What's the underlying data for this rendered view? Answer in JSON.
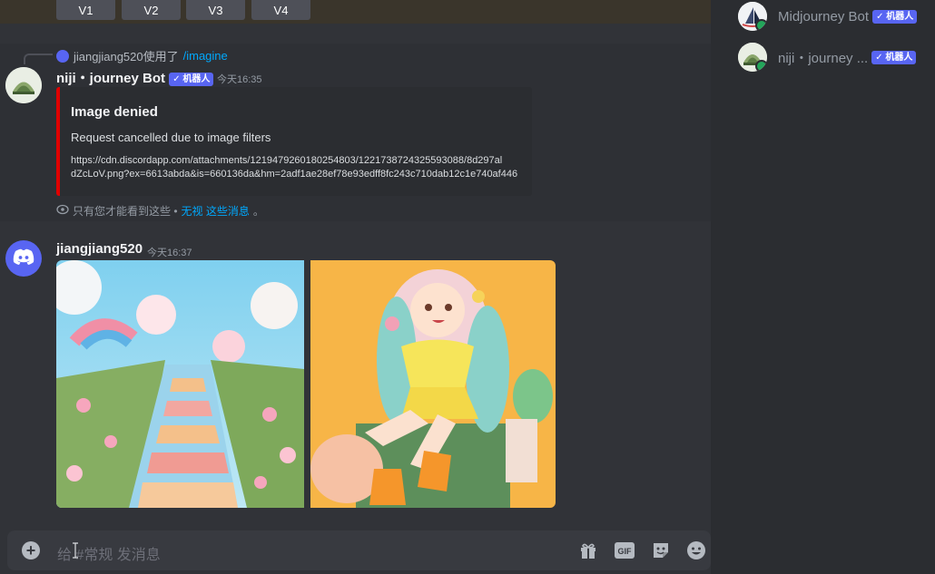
{
  "vbuttons": [
    "V1",
    "V2",
    "V3",
    "V4"
  ],
  "reply": {
    "user": "jiangjiang520使用了",
    "command": "/imagine"
  },
  "bot_message": {
    "name": "niji・journey Bot",
    "badge": "✓ 机器人",
    "time": "今天16:35",
    "embed": {
      "title": "Image denied",
      "description": "Request cancelled due to image filters",
      "url_line1": "https://cdn.discordapp.com/attachments/1219479260180254803/1221738724325593088/8d297al",
      "url_line2": "dZcLoV.png?ex=6613abda&is=660136da&hm=2adf1ae28ef78e93edff8fc243c710dab12c1e740af446"
    },
    "ephemeral": {
      "text": "只有您才能看到这些 •",
      "link": "无视 这些消息",
      "end": "。"
    }
  },
  "user_message": {
    "name": "jiangjiang520",
    "time": "今天16:37"
  },
  "composer": {
    "placeholder": "给 #常规 发消息"
  },
  "members": [
    {
      "name": "Midjourney Bot",
      "badge": "✓ 机器人"
    },
    {
      "name": "niji・journey ...",
      "badge": "✓ 机器人"
    }
  ],
  "icons": [
    "plus-icon",
    "gift-icon",
    "gif-icon",
    "sticker-icon",
    "emoji-icon",
    "eye-icon",
    "discord-logo-icon"
  ]
}
